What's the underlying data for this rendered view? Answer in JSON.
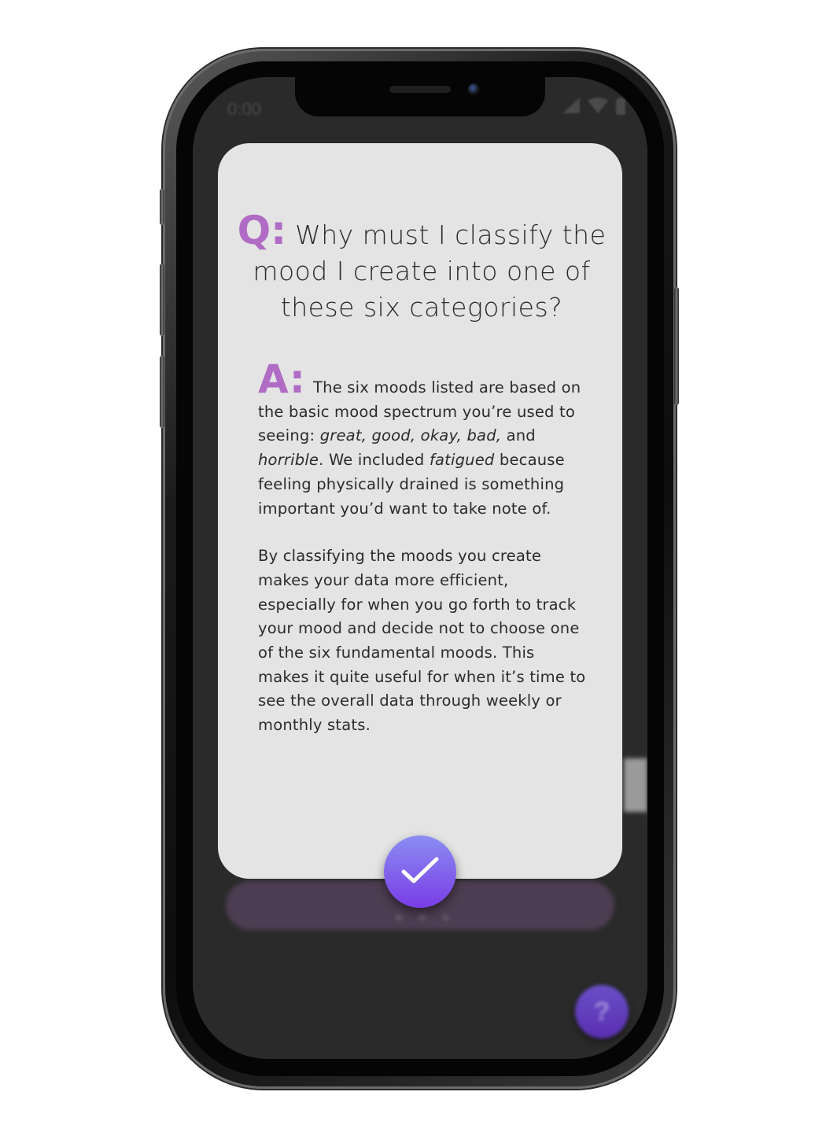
{
  "status_bar": {
    "time": "0:00",
    "icons": [
      "signal-icon",
      "wifi-icon",
      "battery-icon"
    ]
  },
  "dialog": {
    "question_prefix": "Q:",
    "question_text": "Why must I classify the mood I create into one of these six categories?",
    "answer_prefix": "A:",
    "answer_para1": {
      "t1": "The six moods listed are based on the basic mood spectrum you’re used to seeing: ",
      "i1": "great, good, okay, bad,",
      "t2": " and ",
      "i2": "horrible",
      "t3": ". We included ",
      "i3": "fatigued",
      "t4": " because feeling physically drained is something important you’d want to take note of."
    },
    "answer_para2": "By classifying the moods you create makes your data more efficient, especially for when you go forth to track your mood and decide not to choose one of the six fundamental moods. This makes it quite useful for when it’s time to see the overall data through weekly or monthly stats.",
    "confirm_icon": "checkmark-icon"
  },
  "background": {
    "pill_dots": "• • •",
    "help_label": "?"
  },
  "colors": {
    "accent": "#b06bc4",
    "dialog_bg": "#e4e4e4",
    "confirm_gradient_top": "#8a8ef2",
    "confirm_gradient_bottom": "#7a3ce6",
    "screen_bg": "#2a2a2a"
  }
}
